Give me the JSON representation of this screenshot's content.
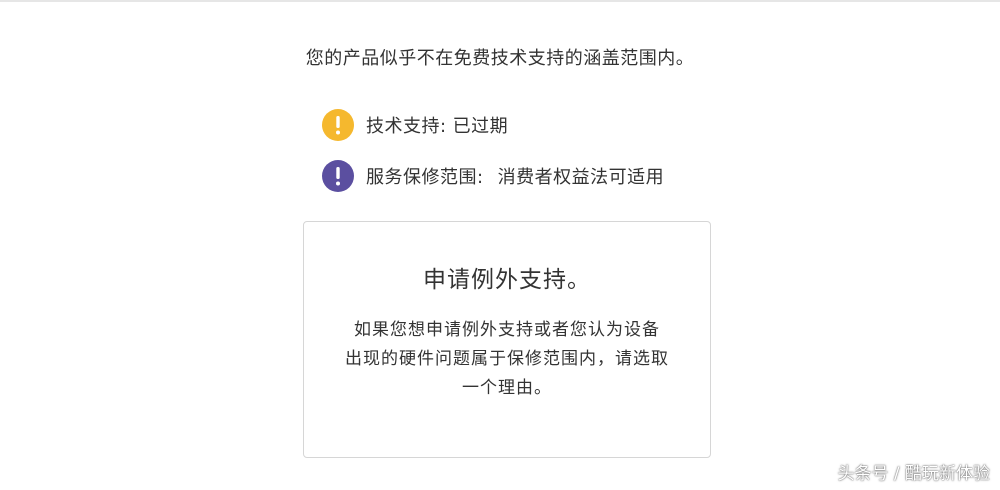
{
  "headline": "您的产品似乎不在免费技术支持的涵盖范围内。",
  "status_items": [
    {
      "icon": "warning-icon",
      "color": "#F5B82E",
      "label": "技术支持:",
      "value": "已过期"
    },
    {
      "icon": "info-alert-icon",
      "color": "#5B4FA0",
      "label": "服务保修范围:",
      "value": "消费者权益法可适用"
    }
  ],
  "exception_card": {
    "title": "申请例外支持。",
    "body_lines": [
      "如果您想申请例外支持或者您认为设备",
      "出现的硬件问题属于保修范围内，请选取",
      "一个理由。"
    ]
  },
  "watermark": "头条号 / 酷玩新体验"
}
